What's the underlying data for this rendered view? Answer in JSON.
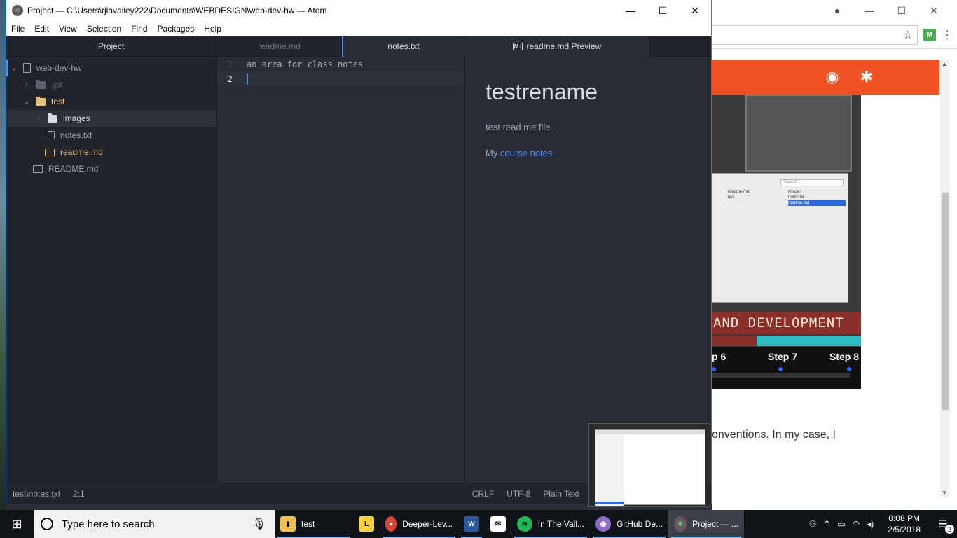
{
  "atom": {
    "title": "Project — C:\\Users\\rjlavalley222\\Documents\\WEBDESIGN\\web-dev-hw — Atom",
    "menu": [
      "File",
      "Edit",
      "View",
      "Selection",
      "Find",
      "Packages",
      "Help"
    ],
    "tree_header": "Project",
    "tree": {
      "root": "web-dev-hw",
      "git": ".git",
      "test": "test",
      "images": "images",
      "notes": "notes.txt",
      "readme_test": "readme.md",
      "readme_root": "README.md"
    },
    "tabs": {
      "readme": "readme.md",
      "notes": "notes.txt",
      "preview_badge": "M↓",
      "preview": "readme.md Preview"
    },
    "editor": {
      "lines": [
        {
          "num": "1",
          "text": "an area for class notes"
        },
        {
          "num": "2",
          "text": ""
        }
      ]
    },
    "preview": {
      "heading": "testrename",
      "para1": "test read me file",
      "para2_prefix": "My ",
      "para2_link": "course notes"
    },
    "status": {
      "path": "test\\notes.txt",
      "position": "2:1",
      "line_ending": "CRLF",
      "encoding": "UTF-8",
      "grammar": "Plain Text"
    }
  },
  "chrome": {
    "extension_badge": "M",
    "site_banner_text": "AND DEVELOPMENT",
    "steps": [
      "p 6",
      "Step 7",
      "Step 8"
    ],
    "body_text": "onventions. In my case, I",
    "finder": {
      "search": "Search",
      "col1": [
        "readme.md",
        "test"
      ],
      "col2": [
        "images",
        "notes.txt",
        "readme.md"
      ]
    }
  },
  "taskbar": {
    "search_placeholder": "Type here to search",
    "items": [
      {
        "label": "test",
        "icon": "folder-icon",
        "color": "#f0c24b"
      },
      {
        "label": "",
        "icon": "live-icon",
        "color": "#f7d33b"
      },
      {
        "label": "Deeper-Lev...",
        "icon": "chrome-icon",
        "color": "#db4437"
      },
      {
        "label": "",
        "icon": "word-icon",
        "color": "#2b579a"
      },
      {
        "label": "",
        "icon": "mail-icon",
        "color": "#ffffff"
      },
      {
        "label": "In The Vall...",
        "icon": "spotify-icon",
        "color": "#1db954"
      },
      {
        "label": "GitHub De...",
        "icon": "github-desktop-icon",
        "color": "#8e6cc8"
      },
      {
        "label": "Project — ...",
        "icon": "atom-icon",
        "color": "#66595c"
      }
    ],
    "time": "8:08 PM",
    "date": "2/5/2018",
    "notifications": "2"
  }
}
